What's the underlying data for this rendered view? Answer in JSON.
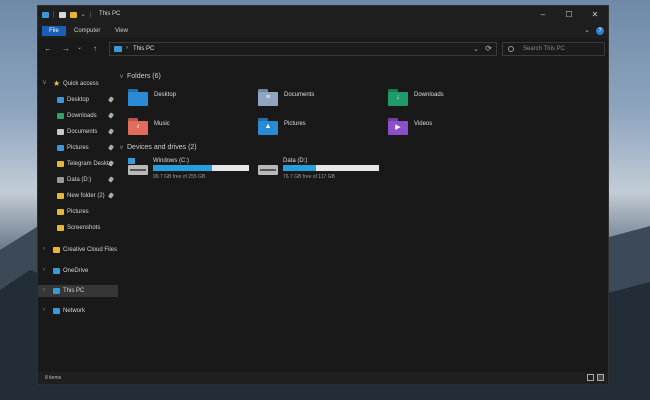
{
  "window": {
    "title": "This PC"
  },
  "ribbon": {
    "tabs": [
      "File",
      "Computer",
      "View"
    ]
  },
  "address": {
    "path": "This PC"
  },
  "search": {
    "placeholder": "Search This PC"
  },
  "sidebar": {
    "items": [
      {
        "label": "Quick access",
        "icon": "star-icon",
        "color": "#f5c542",
        "level": 0,
        "expand": "v",
        "pinned": false
      },
      {
        "label": "Desktop",
        "icon": "desktop-icon",
        "color": "#3a9ad9",
        "level": 1,
        "pinned": true
      },
      {
        "label": "Downloads",
        "icon": "downloads-icon",
        "color": "#2ea36b",
        "level": 1,
        "pinned": true
      },
      {
        "label": "Documents",
        "icon": "documents-icon",
        "color": "#c9c9c9",
        "level": 1,
        "pinned": true
      },
      {
        "label": "Pictures",
        "icon": "pictures-icon",
        "color": "#3a9ad9",
        "level": 1,
        "pinned": true
      },
      {
        "label": "Telegram Deskto",
        "icon": "folder-icon",
        "color": "#e8b631",
        "level": 1,
        "pinned": true
      },
      {
        "label": "Data (D:)",
        "icon": "drive-icon",
        "color": "#9a9a9a",
        "level": 1,
        "pinned": true
      },
      {
        "label": "New folder (2)",
        "icon": "folder-icon",
        "color": "#e8b631",
        "level": 1,
        "pinned": true
      },
      {
        "label": "Pictures",
        "icon": "folder-icon",
        "color": "#e8b631",
        "level": 1,
        "pinned": false
      },
      {
        "label": "Screenshots",
        "icon": "folder-icon",
        "color": "#e8b631",
        "level": 1,
        "pinned": false
      },
      {
        "label": "Creative Cloud Files",
        "icon": "creative-cloud-icon",
        "color": "#e8b631",
        "level": 0,
        "expand": ">",
        "pinned": false
      },
      {
        "label": "OneDrive",
        "icon": "cloud-icon",
        "color": "#3a9ad9",
        "level": 0,
        "expand": ">",
        "pinned": false
      },
      {
        "label": "This PC",
        "icon": "this-pc-icon",
        "color": "#3a9ad9",
        "level": 0,
        "expand": ">",
        "pinned": false,
        "selected": true
      },
      {
        "label": "Network",
        "icon": "network-icon",
        "color": "#3a9ad9",
        "level": 0,
        "expand": ">",
        "pinned": false
      }
    ]
  },
  "content": {
    "folders_header": "Folders (6)",
    "folders": [
      {
        "label": "Desktop",
        "icon": "desktop-folder-icon",
        "color": "#2a8ad4",
        "glyph": ""
      },
      {
        "label": "Documents",
        "icon": "documents-folder-icon",
        "color": "#8fa6c0",
        "glyph": "≡"
      },
      {
        "label": "Downloads",
        "icon": "downloads-folder-icon",
        "color": "#1f9a6a",
        "glyph": "↓"
      },
      {
        "label": "Music",
        "icon": "music-folder-icon",
        "color": "#e26c5c",
        "glyph": "♪"
      },
      {
        "label": "Pictures",
        "icon": "pictures-folder-icon",
        "color": "#2a8ad4",
        "glyph": "▲"
      },
      {
        "label": "Videos",
        "icon": "videos-folder-icon",
        "color": "#8b4fc9",
        "glyph": "▶"
      }
    ],
    "devices_header": "Devices and drives (2)",
    "drives": [
      {
        "label": "Windows (C:)",
        "free": "99.7 GB free of 255 GB",
        "used_fraction": 0.61,
        "icon": "windows-drive-icon",
        "has_win": true
      },
      {
        "label": "Data (D:)",
        "free": "76.7 GB free of 117 GB",
        "used_fraction": 0.34,
        "icon": "data-drive-icon",
        "has_win": false
      }
    ]
  },
  "status": {
    "items": "8 items"
  }
}
